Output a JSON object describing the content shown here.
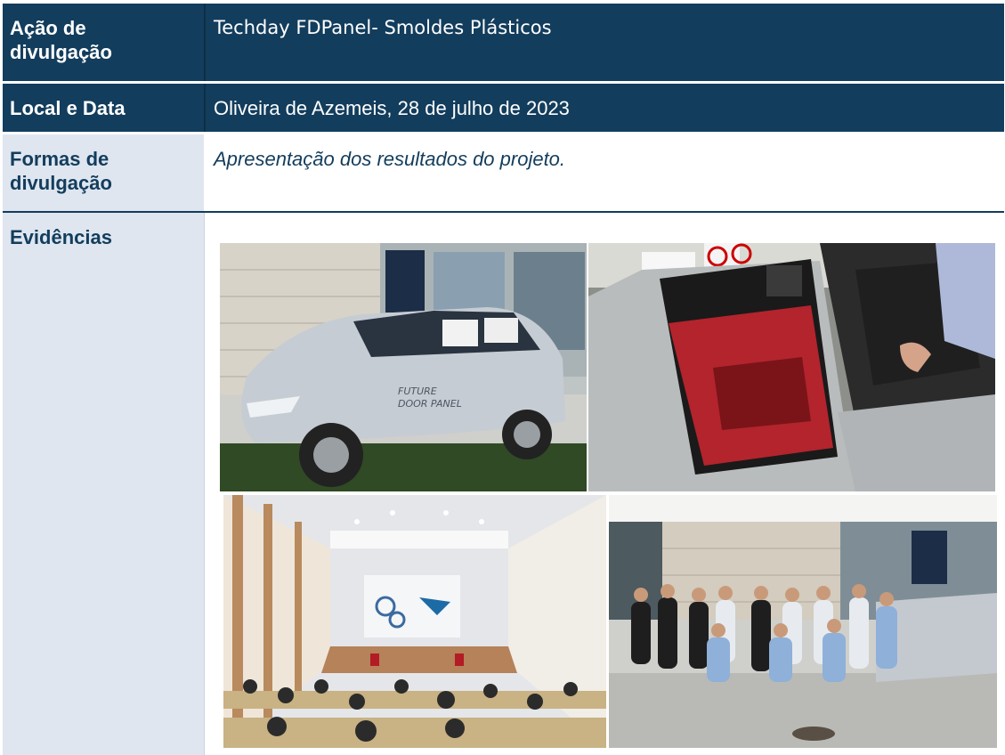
{
  "rows": {
    "acao": {
      "label": "Ação de divulgação",
      "value": "Techday FDPanel- Smoldes Plásticos"
    },
    "local": {
      "label": "Local e Data",
      "value": "Oliveira de Azemeis, 28 de julho de 2023"
    },
    "formas": {
      "label": "Formas de divulgação",
      "value": "Apresentação dos resultados do projeto."
    },
    "evidencias": {
      "label": "Evidências"
    }
  },
  "photos": {
    "car": {
      "door_text_line1": "FUTURE",
      "door_text_line2": "DOOR PANEL"
    },
    "door_panel": {},
    "auditorium": {},
    "group": {}
  },
  "colors": {
    "header_dark": "#133d5d",
    "label_light": "#dfe6ef",
    "text_dark": "#133d5d"
  }
}
